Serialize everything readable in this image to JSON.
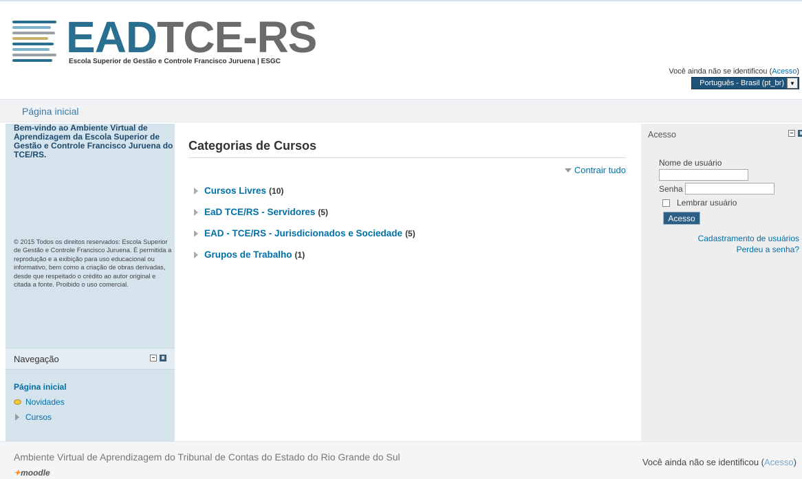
{
  "header": {
    "logo_text_ead": "EAD",
    "logo_text_tce": "TCE",
    "logo_text_rs": "-RS",
    "logo_subtitle": "Escola Superior de Gestão e Controle Francisco Juruena | ESGC",
    "login_prefix": "Você ainda não se identificou (",
    "login_link": "Acesso",
    "login_suffix": ")",
    "language": "Português - Brasil (pt_br)"
  },
  "navbar": {
    "breadcrumb": "Página inicial"
  },
  "left": {
    "welcome": "Bem-vindo ao Ambiente Virtual de Aprendizagem da Escola Superior de Gestão e Controle Francisco Juruena do TCE/RS.",
    "copyright": "© 2015 Todos os direitos reservados: Escola Superior de Gestão e Controle Francisco Juruena. É permitida a reprodução e a exibição para uso educacional ou informativo, bem como a criação de obras derivadas, desde que respeitado o crédito ao autor original e citada a fonte. Proibido o uso comercial.",
    "nav_title": "Navegação",
    "nav_items": [
      "Página inicial",
      "Novidades",
      "Cursos"
    ]
  },
  "main": {
    "title": "Categorias de Cursos",
    "collapse_all": "Contrair tudo",
    "categories": [
      {
        "name": "Cursos Livres",
        "count": "(10)"
      },
      {
        "name": "EaD TCE/RS - Servidores",
        "count": "(5)"
      },
      {
        "name": "EAD - TCE/RS - Jurisdicionados e Sociedade",
        "count": "(5)"
      },
      {
        "name": "Grupos de Trabalho",
        "count": "(1)"
      }
    ]
  },
  "right": {
    "title": "Acesso",
    "username_label": "Nome de usuário",
    "password_label": "Senha",
    "remember_label": "Lembrar usuário",
    "login_button": "Acesso",
    "register_link": "Cadastramento de usuários",
    "forgot_link": "Perdeu a senha?"
  },
  "footer": {
    "description": "Ambiente Virtual de Aprendizagem do Tribunal de Contas do Estado do Rio Grande do Sul",
    "moodle": "moodle",
    "login_prefix": "Você ainda não se identificou (",
    "login_link": "Acesso",
    "login_suffix": ")"
  },
  "colors": {
    "brand": "#2a6f8f",
    "link": "#0070a8",
    "sidebar_bg": "#d4e3ec"
  }
}
